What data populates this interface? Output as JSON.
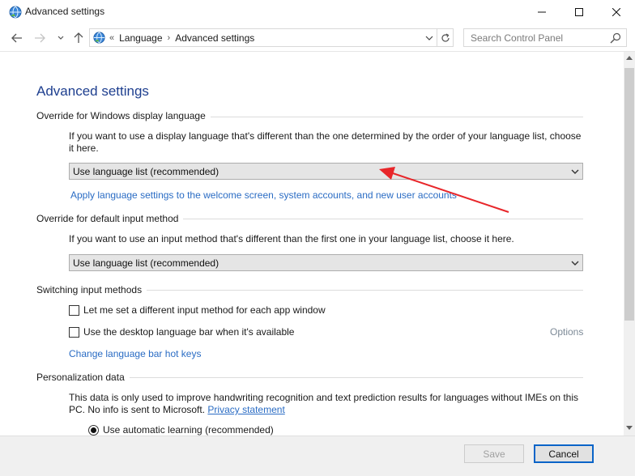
{
  "window": {
    "title": "Advanced settings"
  },
  "address_bar": {
    "overflow": "«",
    "crumbs": [
      "Language",
      "Advanced settings"
    ],
    "search_placeholder": "Search Control Panel"
  },
  "page": {
    "heading": "Advanced settings",
    "sections": {
      "display_language": {
        "title": "Override for Windows display language",
        "description": "If you want to use a display language that's different than the one determined by the order of your language list, choose it here.",
        "selected": "Use language list (recommended)",
        "link": "Apply language settings to the welcome screen, system accounts, and new user accounts"
      },
      "input_method": {
        "title": "Override for default input method",
        "description": "If you want to use an input method that's different than the first one in your language list, choose it here.",
        "selected": "Use language list (recommended)"
      },
      "switching": {
        "title": "Switching input methods",
        "option1": "Let me set a different input method for each app window",
        "option2": "Use the desktop language bar when it's available",
        "options_link": "Options",
        "hotkeys_link": "Change language bar hot keys"
      },
      "personalization": {
        "title": "Personalization data",
        "description": "This data is only used to improve handwriting recognition and text prediction results for languages without IMEs on this PC. No info is sent to Microsoft.",
        "privacy_link": "Privacy statement",
        "radio1": "Use automatic learning (recommended)"
      }
    }
  },
  "footer": {
    "save_label": "Save",
    "cancel_label": "Cancel"
  },
  "colors": {
    "heading": "#1e3f8f",
    "link": "#2a6cc4",
    "annotation": "#e8262a"
  }
}
